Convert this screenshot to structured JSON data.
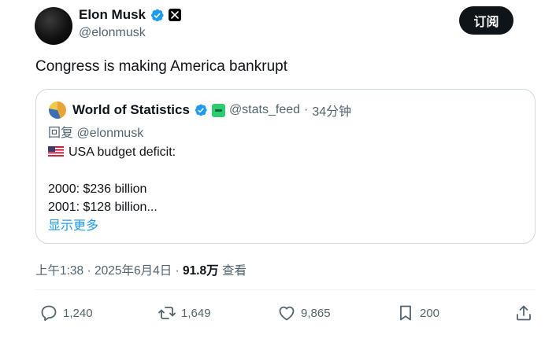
{
  "author": {
    "display_name": "Elon Musk",
    "handle": "@elonmusk",
    "verified_icon": "verified-badge-icon",
    "affiliate_icon": "x-logo-icon",
    "verified_color": "#1d9bf0"
  },
  "subscribe_label": "订阅",
  "tweet_text": "Congress is making America bankrupt",
  "quoted_tweet": {
    "display_name": "World of Statistics",
    "handle": "@stats_feed",
    "separator": "·",
    "time_ago": "34分钟",
    "reply_prefix": "回复",
    "reply_to": "@elonmusk",
    "flag_icon": "us-flag-icon",
    "lines": [
      "USA budget deficit:",
      "2000: $236 billion",
      "2001: $128 billion..."
    ],
    "show_more": "显示更多"
  },
  "meta": {
    "time": "上午1:38",
    "separator": "·",
    "date": "2025年6月4日",
    "views": "91.8万",
    "views_label": "查看"
  },
  "actions": {
    "replies": "1,240",
    "reposts": "1,649",
    "likes": "9,865",
    "bookmarks": "200"
  },
  "colors": {
    "text": "#0f1419",
    "secondary": "#536471",
    "accent": "#1d9bf0",
    "border": "#cfd9de"
  }
}
